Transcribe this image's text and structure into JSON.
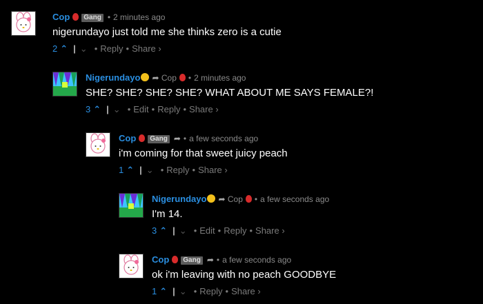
{
  "comments": [
    {
      "author": "Cop",
      "badge": "Gang",
      "reply_to": "",
      "time": "2 minutes ago",
      "text": "nigerundayo just told me she thinks zero is a cutie",
      "score": "2",
      "actions": [
        "Reply",
        "Share ›"
      ],
      "avatar": "cop-avatar"
    },
    {
      "author": "Nigerundayo",
      "badge": "",
      "reply_to": "Cop",
      "time": "2 minutes ago",
      "text": "SHE? SHE? SHE? SHE? WHAT ABOUT ME SAYS FEMALE?!",
      "score": "3",
      "actions": [
        "Edit",
        "Reply",
        "Share ›"
      ],
      "avatar": "nigerundayo-avatar"
    },
    {
      "author": "Cop",
      "badge": "Gang",
      "reply_to": "",
      "time": "a few seconds ago",
      "text": "i'm coming for that sweet juicy peach",
      "score": "1",
      "actions": [
        "Reply",
        "Share ›"
      ],
      "avatar": "cop-avatar"
    },
    {
      "author": "Nigerundayo",
      "badge": "",
      "reply_to": "Cop",
      "time": "a few seconds ago",
      "text": "I'm 14.",
      "score": "3",
      "actions": [
        "Edit",
        "Reply",
        "Share ›"
      ],
      "avatar": "nigerundayo-avatar"
    },
    {
      "author": "Cop",
      "badge": "Gang",
      "reply_to": "",
      "time": "a few seconds ago",
      "text": "ok i'm leaving with no peach GOODBYE",
      "score": "1",
      "actions": [
        "Reply",
        "Share ›"
      ],
      "avatar": "cop-avatar"
    }
  ],
  "colors": {
    "author": "#2a8ee0",
    "background": "#000000",
    "meta": "#8a8a8a",
    "badge": "#5c5c5c"
  },
  "icons": {
    "upvote": "chevron-up-icon",
    "downvote": "chevron-down-icon",
    "reply": "reply-arrow-icon"
  }
}
